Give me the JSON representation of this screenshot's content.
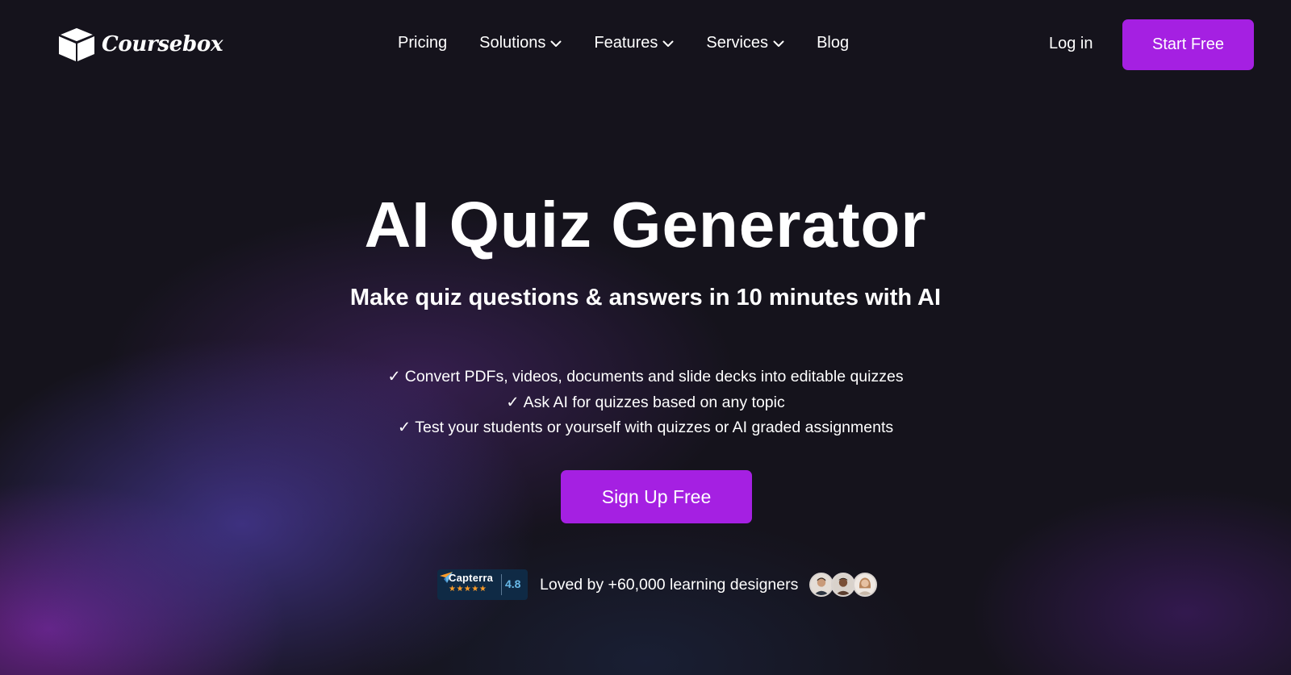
{
  "header": {
    "logo_text": "Coursebox",
    "nav": [
      {
        "label": "Pricing"
      },
      {
        "label": "Solutions"
      },
      {
        "label": "Features"
      },
      {
        "label": "Services"
      },
      {
        "label": "Blog"
      }
    ],
    "login_label": "Log in",
    "start_label": "Start Free"
  },
  "hero": {
    "title": "AI Quiz Generator",
    "subtitle": "Make quiz questions & answers in 10 minutes with AI",
    "check_glyph": "✓",
    "features": [
      "Convert PDFs, videos, documents and slide decks into editable quizzes",
      "Ask AI for quizzes based on any topic",
      "Test your students or yourself with quizzes or AI graded assignments"
    ],
    "signup_label": "Sign Up Free"
  },
  "proof": {
    "capterra_name": "Capterra",
    "capterra_stars": "★★★★★",
    "capterra_score": "4.8",
    "text": "Loved by +60,000 learning designers"
  },
  "colors": {
    "accent": "#a520e2",
    "background": "#15131c",
    "capterra_bg": "#0f2a45",
    "capterra_score": "#68b9e8",
    "star": "#ff9d28"
  },
  "icons": {
    "logo": "box-icon",
    "dropdown": "chevron-down-icon",
    "capterra": "capterra-arrow-icon"
  }
}
